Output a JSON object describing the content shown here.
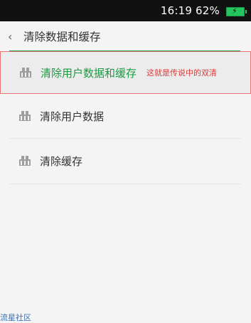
{
  "status": {
    "time": "16:19",
    "battery_percent": "62%",
    "battery_icon": "battery-charging-icon",
    "battery_color": "#22c55e"
  },
  "header": {
    "back_icon": "chevron-left-icon",
    "title": "清除数据和缓存"
  },
  "options": [
    {
      "label": "清除用户数据和缓存",
      "annotation": "这就是传说中的双清",
      "icon": "broom-icon",
      "selected": true
    },
    {
      "label": "清除用户数据",
      "icon": "broom-icon"
    },
    {
      "label": "清除缓存",
      "icon": "broom-icon"
    }
  ],
  "watermark": "流星社区",
  "colors": {
    "accent": "#1c9a43",
    "annotation": "#d83a3a",
    "highlight_border": "#e57373",
    "background": "#f4f4f4"
  }
}
